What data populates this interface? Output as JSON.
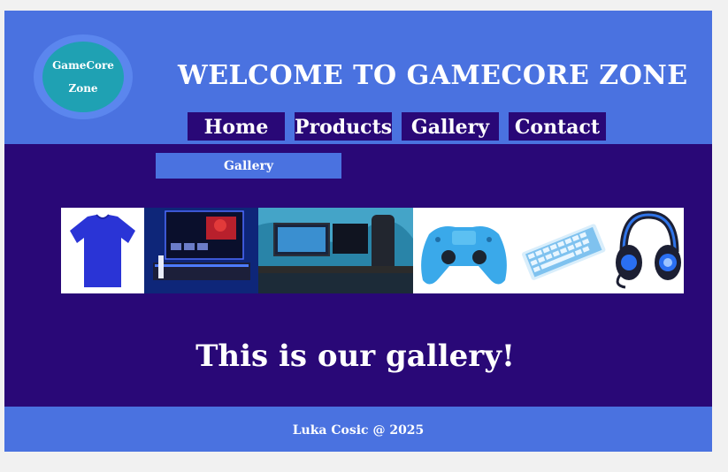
{
  "logo": {
    "line1": "GameCore",
    "line2": "Zone"
  },
  "header": {
    "title": "WELCOME TO GAMECORE ZONE"
  },
  "nav": [
    {
      "label": "Home"
    },
    {
      "label": "Products"
    },
    {
      "label": "Gallery"
    },
    {
      "label": "Contact"
    }
  ],
  "section": {
    "label": "Gallery"
  },
  "gallery": {
    "images": [
      {
        "name": "blue-tshirt"
      },
      {
        "name": "ps5-tv-setup"
      },
      {
        "name": "gaming-pc-desk"
      },
      {
        "name": "blue-controller"
      },
      {
        "name": "blue-keyboard"
      },
      {
        "name": "gaming-headset"
      }
    ]
  },
  "main": {
    "tagline": "This is our gallery!"
  },
  "footer": {
    "text": "Luka Cosic @ 2025"
  },
  "colors": {
    "header_bg": "#4a72e0",
    "main_bg": "#290877",
    "logo_teal": "#1fa1b3",
    "page_bg": "#f1f1f1"
  }
}
